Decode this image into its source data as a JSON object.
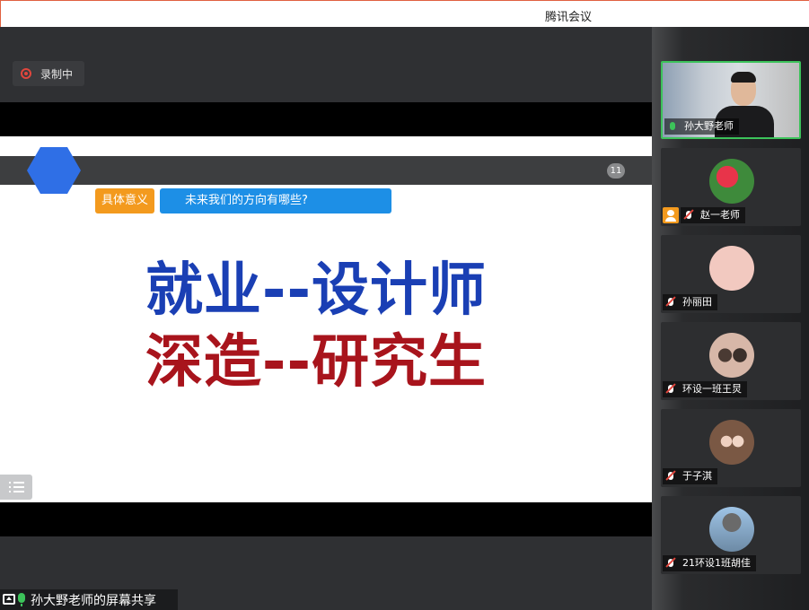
{
  "window": {
    "title": "腾讯会议"
  },
  "recording": {
    "label": "录制中"
  },
  "slide": {
    "page_number": "11",
    "tag_left": "具体意义",
    "tag_right": "未来我们的方向有哪些?",
    "headline_1": "就业--设计师",
    "headline_2": "深造--研究生"
  },
  "share": {
    "label": "孙大野老师的屏幕共享"
  },
  "participants": [
    {
      "name": "孙大野老师",
      "mic": "on",
      "video": "camera"
    },
    {
      "name": "赵一老师",
      "mic": "muted",
      "avatar": "flower-icon"
    },
    {
      "name": "孙丽田",
      "mic": "muted",
      "avatar": "runner-icon"
    },
    {
      "name": "环设一班王炅",
      "mic": "muted",
      "avatar": "couple-icon"
    },
    {
      "name": "于子淇",
      "mic": "muted",
      "avatar": "girls-icon"
    },
    {
      "name": "21环设1班胡佳",
      "mic": "muted",
      "avatar": "hat-icon"
    }
  ],
  "colors": {
    "accent_green": "#3cc35a",
    "record_red": "#e0463d",
    "headline_blue": "#1a3fb4",
    "headline_red": "#a8141c",
    "tag_orange": "#f39a1e",
    "tag_blue": "#1d8fe6"
  }
}
